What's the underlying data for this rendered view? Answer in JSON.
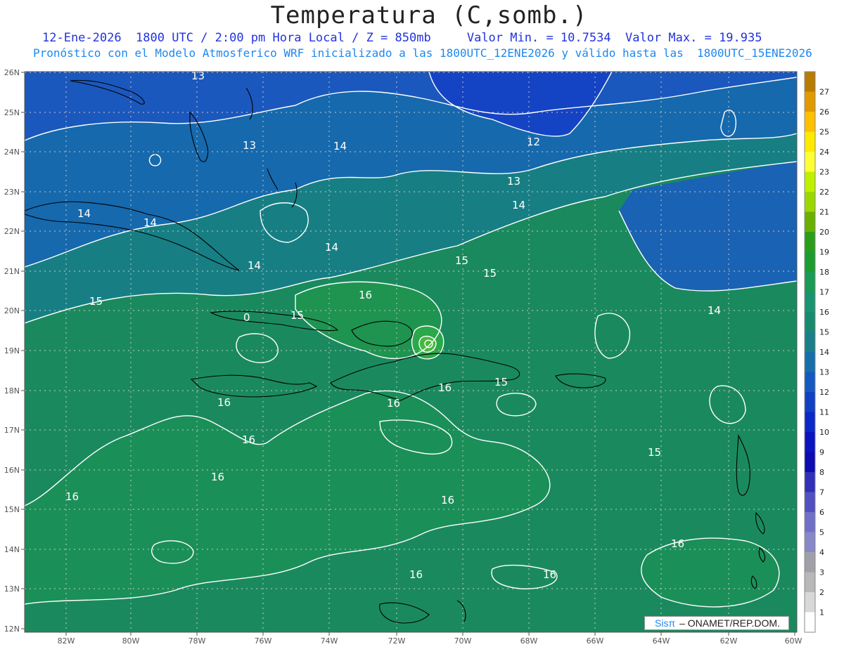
{
  "header": {
    "title": "Temperatura (C,somb.)",
    "line1": "12-Ene-2026  1800 UTC / 2:00 pm Hora Local / Z = 850mb     Valor Min. = 10.7534  Valor Max. = 19.935",
    "line2": "Pronóstico con el Modelo Atmosferico WRF inicializado a las 1800UTC_12ENE2026 y válido hasta las  1800UTC_15ENE2026"
  },
  "axes": {
    "lat_labels": [
      "26N",
      "25N",
      "24N",
      "23N",
      "22N",
      "21N",
      "20N",
      "19N",
      "18N",
      "17N",
      "16N",
      "15N",
      "14N",
      "13N",
      "12N"
    ],
    "lon_labels": [
      "82W",
      "80W",
      "78W",
      "76W",
      "74W",
      "72W",
      "70W",
      "68W",
      "66W",
      "64W",
      "62W",
      "60W"
    ]
  },
  "contour_labels": [
    {
      "text": "13"
    },
    {
      "text": "13"
    },
    {
      "text": "14"
    },
    {
      "text": "12"
    },
    {
      "text": "13"
    },
    {
      "text": "14"
    },
    {
      "text": "14"
    },
    {
      "text": "14"
    },
    {
      "text": "14"
    },
    {
      "text": "14"
    },
    {
      "text": "15"
    },
    {
      "text": "15"
    },
    {
      "text": "16"
    },
    {
      "text": "15"
    },
    {
      "text": "15"
    },
    {
      "text": "0"
    },
    {
      "text": "14"
    },
    {
      "text": "16"
    },
    {
      "text": "15"
    },
    {
      "text": "16"
    },
    {
      "text": "16"
    },
    {
      "text": "16"
    },
    {
      "text": "15"
    },
    {
      "text": "16"
    },
    {
      "text": "16"
    },
    {
      "text": "16"
    },
    {
      "text": "16"
    },
    {
      "text": "16"
    },
    {
      "text": "16"
    }
  ],
  "colorbar": {
    "labels": [
      "27",
      "26",
      "25",
      "24",
      "23",
      "22",
      "21",
      "20",
      "19",
      "18",
      "17",
      "16",
      "15",
      "14",
      "13",
      "12",
      "11",
      "10",
      "9",
      "8",
      "7",
      "6",
      "5",
      "4",
      "3",
      "2",
      "1"
    ],
    "colors": [
      "#b87c00",
      "#e09a00",
      "#ffc000",
      "#ffea00",
      "#ffff33",
      "#bff000",
      "#9ad800",
      "#6ab000",
      "#2a9e1a",
      "#1c9c30",
      "#1b9a55",
      "#1a9370",
      "#178a70",
      "#1a7f8a",
      "#166fa8",
      "#1459c0",
      "#1040c4",
      "#0c28c8",
      "#0a14c0",
      "#0c0cb0",
      "#3030b8",
      "#5050c0",
      "#7070c8",
      "#8888c8",
      "#a0a0a8",
      "#b8b8b8",
      "#d8d8d8",
      "#ffffff"
    ]
  },
  "footer": {
    "logo": "Sisπ",
    "text": "– ONAMET/REP.DOM."
  }
}
